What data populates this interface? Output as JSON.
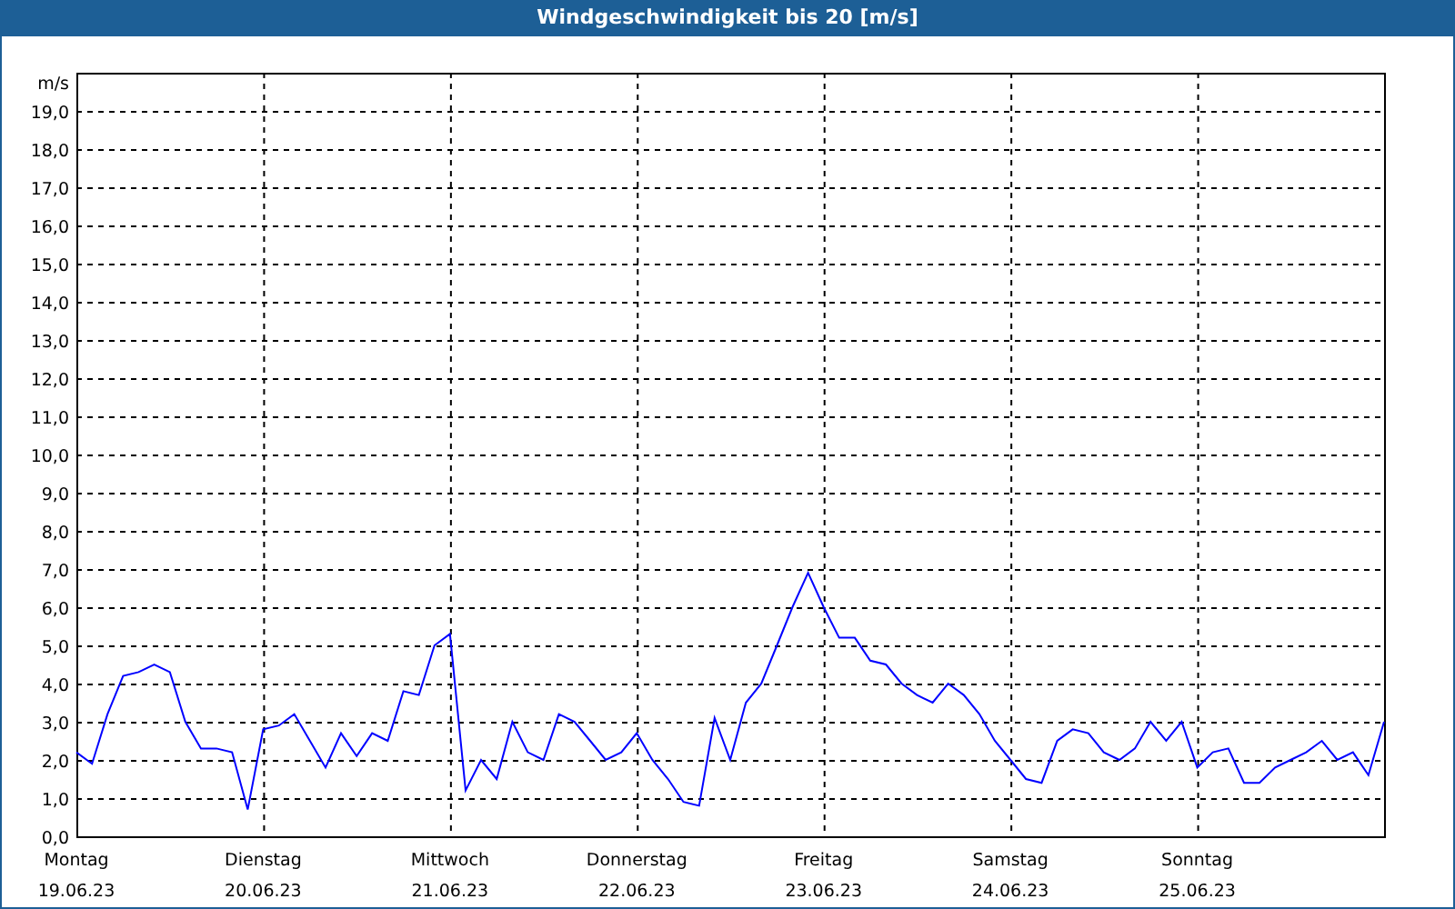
{
  "window": {
    "title": "Windgeschwindigkeit bis 20 [m/s]"
  },
  "chart": {
    "chart_data": {
      "type": "line",
      "grid": true,
      "ylabel": "m/s",
      "ylim": [
        0,
        20
      ],
      "yticks": [
        {
          "value": 0,
          "label": "0,0"
        },
        {
          "value": 1,
          "label": "1,0"
        },
        {
          "value": 2,
          "label": "2,0"
        },
        {
          "value": 3,
          "label": "3,0"
        },
        {
          "value": 4,
          "label": "4,0"
        },
        {
          "value": 5,
          "label": "5,0"
        },
        {
          "value": 6,
          "label": "6,0"
        },
        {
          "value": 7,
          "label": "7,0"
        },
        {
          "value": 8,
          "label": "8,0"
        },
        {
          "value": 9,
          "label": "9,0"
        },
        {
          "value": 10,
          "label": "10,0"
        },
        {
          "value": 11,
          "label": "11,0"
        },
        {
          "value": 12,
          "label": "12,0"
        },
        {
          "value": 13,
          "label": "13,0"
        },
        {
          "value": 14,
          "label": "14,0"
        },
        {
          "value": 15,
          "label": "15,0"
        },
        {
          "value": 16,
          "label": "16,0"
        },
        {
          "value": 17,
          "label": "17,0"
        },
        {
          "value": 18,
          "label": "18,0"
        },
        {
          "value": 19,
          "label": "19,0"
        }
      ],
      "categories": [
        "Montag 19.06.23",
        null,
        null,
        null,
        null,
        null,
        null,
        null,
        null,
        null,
        null,
        null,
        "Dienstag 20.06.23",
        null,
        null,
        null,
        null,
        null,
        null,
        null,
        null,
        null,
        null,
        null,
        "Mittwoch 21.06.23",
        null,
        null,
        null,
        null,
        null,
        null,
        null,
        null,
        null,
        null,
        null,
        "Donnerstag 22.06.23",
        null,
        null,
        null,
        null,
        null,
        null,
        null,
        null,
        null,
        null,
        null,
        "Freitag 23.06.23",
        null,
        null,
        null,
        null,
        null,
        null,
        null,
        null,
        null,
        null,
        null,
        "Samstag 24.06.23",
        null,
        null,
        null,
        null,
        null,
        null,
        null,
        null,
        null,
        null,
        null,
        "Sonntag 25.06.23",
        null,
        null,
        null,
        null,
        null,
        null,
        null,
        null,
        null,
        null,
        null,
        null
      ],
      "series": [
        {
          "color": "#0000ff",
          "values": [
            2.2,
            1.9,
            3.2,
            4.2,
            4.3,
            4.5,
            4.3,
            3.0,
            2.3,
            2.3,
            2.2,
            0.7,
            2.8,
            2.9,
            3.2,
            2.5,
            1.8,
            2.7,
            2.1,
            2.7,
            2.5,
            3.8,
            3.7,
            5.0,
            5.3,
            1.2,
            2.0,
            1.5,
            3.0,
            2.2,
            2.0,
            3.2,
            3.0,
            2.5,
            2.0,
            2.2,
            2.7,
            2.0,
            1.5,
            0.9,
            0.8,
            3.1,
            2.0,
            3.5,
            4.0,
            5.0,
            6.0,
            6.9,
            6.0,
            5.2,
            5.2,
            4.6,
            4.5,
            4.0,
            3.7,
            3.5,
            4.0,
            3.7,
            3.2,
            2.5,
            2.0,
            1.5,
            1.4,
            2.5,
            2.8,
            2.7,
            2.2,
            2.0,
            2.3,
            3.0,
            2.5,
            3.0,
            1.8,
            2.2,
            2.3,
            1.4,
            1.4,
            1.8,
            2.0,
            2.2,
            2.5,
            2.0,
            2.2,
            1.6,
            3.0
          ]
        }
      ]
    }
  }
}
